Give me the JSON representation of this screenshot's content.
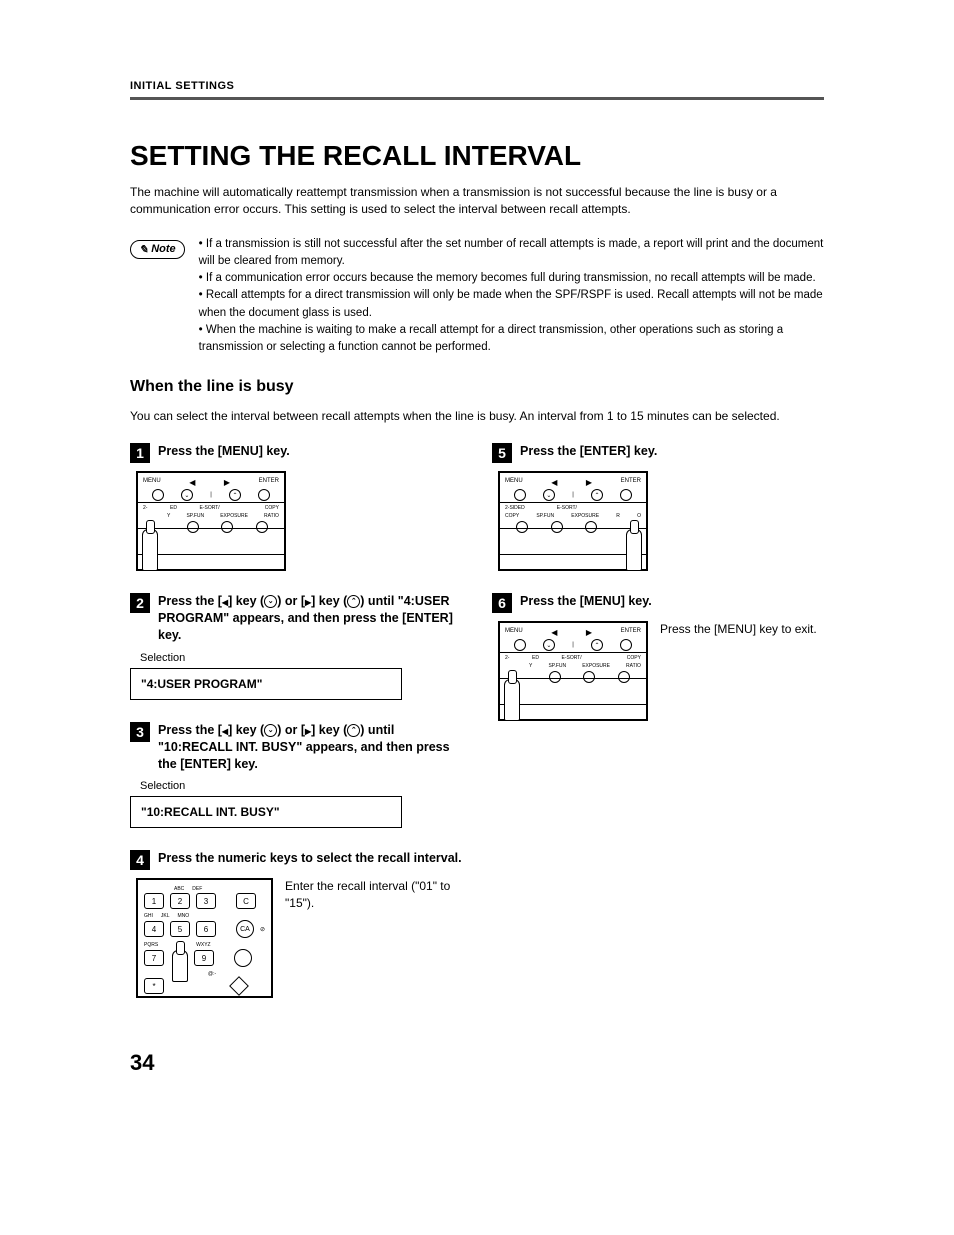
{
  "header": "INITIAL SETTINGS",
  "title": "SETTING THE RECALL INTERVAL",
  "intro": "The machine will automatically reattempt transmission when a transmission is not successful because the line is busy or a communication error occurs. This setting is used to select the interval between recall attempts.",
  "note_label": "Note",
  "notes": [
    "If a transmission is still not successful after the set number of recall attempts is made, a report will print and the document will be cleared from memory.",
    "If a communication error occurs because the memory becomes full during transmission, no recall attempts will be made.",
    "Recall attempts for a direct transmission will only be made when the SPF/RSPF is used. Recall attempts will not be made when the document glass is used.",
    "When the machine is waiting to make a recall attempt for a direct transmission, other operations such as storing a transmission or selecting a function cannot be performed."
  ],
  "subheading": "When the line is busy",
  "subtext": "You can select the interval between recall attempts when the line is busy. An interval from 1 to 15 minutes can be selected.",
  "steps": {
    "s1": {
      "num": "1",
      "title": "Press the [MENU] key."
    },
    "s2": {
      "num": "2",
      "title_pre": "Press the [",
      "title_mid1": "] key (",
      "title_mid2": ") or [",
      "title_mid3": "] key (",
      "title_post": ") until \"4:USER PROGRAM\" appears, and then press the [ENTER] key.",
      "selection": "Selection",
      "display": "\"4:USER PROGRAM\""
    },
    "s3": {
      "num": "3",
      "title_pre": "Press the [",
      "title_mid1": "] key (",
      "title_mid2": ") or [",
      "title_mid3": "] key (",
      "title_post": ") until \"10:RECALL INT. BUSY\" appears, and then press the [ENTER] key.",
      "selection": "Selection",
      "display": "\"10:RECALL INT. BUSY\""
    },
    "s4": {
      "num": "4",
      "title": "Press the numeric keys to select the recall interval.",
      "text": "Enter the recall interval (\"01\" to \"15\")."
    },
    "s5": {
      "num": "5",
      "title": "Press the [ENTER] key."
    },
    "s6": {
      "num": "6",
      "title": "Press the [MENU] key.",
      "text": "Press the [MENU] key to exit."
    }
  },
  "panel": {
    "menu": "MENU",
    "enter": "ENTER",
    "twosided": "2-SIDED",
    "copy": "COPY",
    "esort": "E-SORT/",
    "spfun": "SP.FUN",
    "exposure": "EXPOSURE",
    "ratio": "RATIO",
    "ed": "ED",
    "y": "Y"
  },
  "keypad": {
    "abc": "ABC",
    "def": "DEF",
    "ghi": "GHI",
    "jkl": "JKL",
    "mno": "MNO",
    "pqrs": "PQRS",
    "wxyz": "WXYZ",
    "k1": "1",
    "k2": "2",
    "k3": "3",
    "k4": "4",
    "k5": "5",
    "k6": "6",
    "k7": "7",
    "k9": "9",
    "star": "*",
    "c": "C",
    "ca": "CA",
    "at": "@:-"
  },
  "page": "34"
}
